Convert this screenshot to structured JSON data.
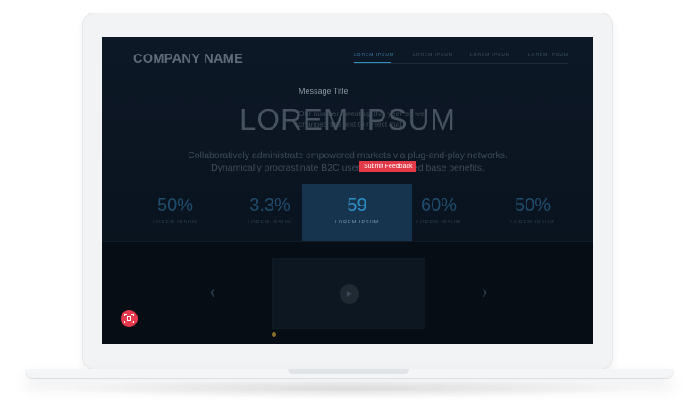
{
  "site": {
    "brand": "COMPANY NAME",
    "nav": [
      "LOREM IPSUM",
      "LOREM IPSUM",
      "LOREM IPSUM",
      "LOREM IPSUM"
    ]
  },
  "message": {
    "title": "Message Title",
    "body": "Our numbers went up this year so we changed this text to reflect that."
  },
  "hero": {
    "heading": "LOREM IPSUM",
    "subtext_line1": "Collaboratively administrate empowered markets via plug-and-play networks.",
    "subtext_line2": "Dynamically procrastinate B2C users after installed base benefits."
  },
  "feedback_button": "Submit Feedback",
  "stats": [
    {
      "value": "50%",
      "label": "LOREM IPSUM"
    },
    {
      "value": "3.3%",
      "label": "LOREM IPSUM"
    },
    {
      "value": "59",
      "label": "LOREM IPSUM"
    },
    {
      "value": "60%",
      "label": "LOREM IPSUM"
    },
    {
      "value": "50%",
      "label": "LOREM IPSUM"
    }
  ],
  "icons": {
    "prev": "chevron-left-icon",
    "next": "chevron-right-icon",
    "play": "play-icon",
    "screenshot": "capture-icon"
  },
  "colors": {
    "accent": "#2f8fc7",
    "feedback": "#e33a4a",
    "active_stat_bg": "#17344f"
  }
}
